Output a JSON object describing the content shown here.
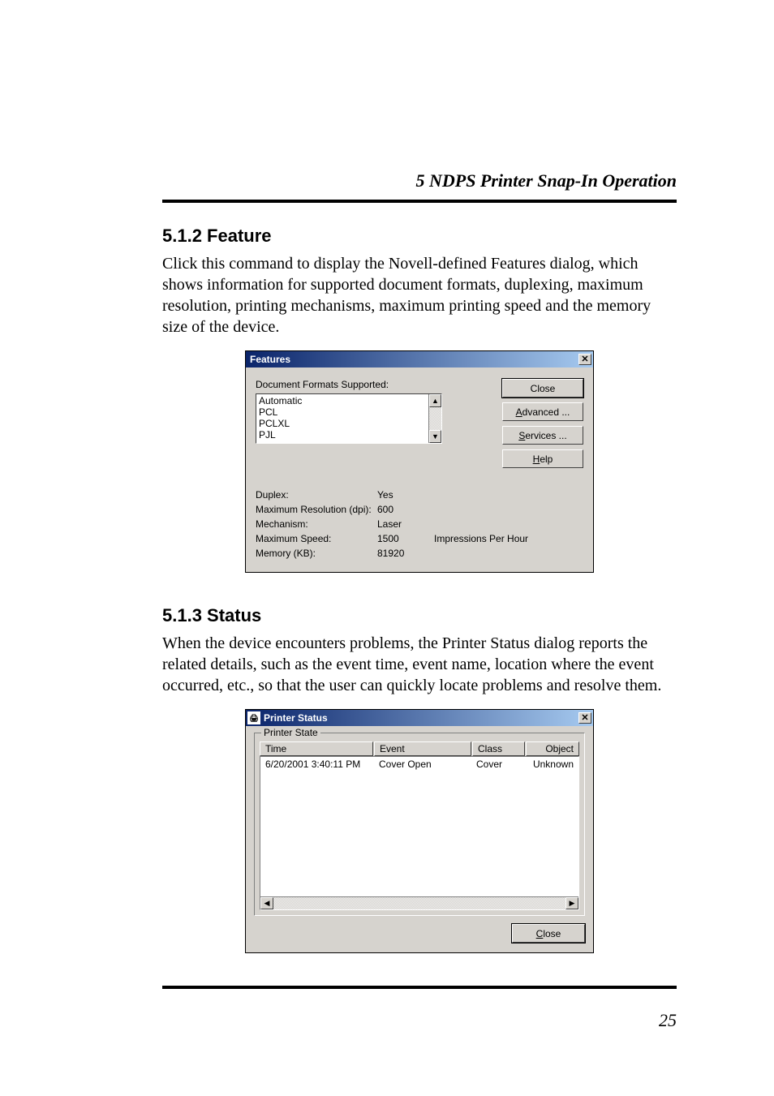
{
  "header": {
    "running": "5  NDPS Printer Snap-In Operation"
  },
  "section1": {
    "num_title": "5.1.2   Feature",
    "paragraph": "Click this command to display the Novell-defined Features dialog, which shows information for supported document formats, duplexing, maximum resolution, printing mechanisms, maximum printing speed and the memory size of the device."
  },
  "features_dlg": {
    "title": "Features",
    "close_glyph": "✕",
    "formats_label": "Document Formats Supported:",
    "formats": [
      "Automatic",
      "PCL",
      "PCLXL",
      "PJL"
    ],
    "scroll_up": "▲",
    "scroll_down": "▼",
    "buttons": {
      "close": "Close",
      "advanced_pre": "",
      "advanced_accel": "A",
      "advanced_rest": "dvanced ...",
      "services_pre": "",
      "services_accel": "S",
      "services_rest": "ervices ...",
      "help_pre": "",
      "help_accel": "H",
      "help_rest": "elp"
    },
    "rows": {
      "duplex_label": "Duplex:",
      "duplex_val": "Yes",
      "maxres_label": "Maximum Resolution (dpi):",
      "maxres_val": "600",
      "mech_label": "Mechanism:",
      "mech_val": "Laser",
      "maxspeed_label": "Maximum Speed:",
      "maxspeed_val": "1500",
      "maxspeed_unit": "Impressions Per Hour",
      "memory_label": "Memory (KB):",
      "memory_val": "81920"
    }
  },
  "section2": {
    "num_title": "5.1.3   Status",
    "paragraph": "When the device encounters problems, the Printer Status dialog reports the related details, such as the event time, event name, location where the event occurred, etc., so that the user can quickly locate problems and resolve them."
  },
  "status_dlg": {
    "title": "Printer Status",
    "icon_text": "🖨",
    "close_glyph": "✕",
    "group_label": "Printer State",
    "headers": {
      "time": "Time",
      "event": "Event",
      "class": "Class",
      "object": "Object"
    },
    "row": {
      "time": "6/20/2001 3:40:11 PM",
      "event": "Cover Open",
      "class": "Cover",
      "object": "Unknown"
    },
    "scroll_left": "◀",
    "scroll_right": "▶",
    "close_pre": "",
    "close_accel": "C",
    "close_rest": "lose"
  },
  "page_number": "25"
}
